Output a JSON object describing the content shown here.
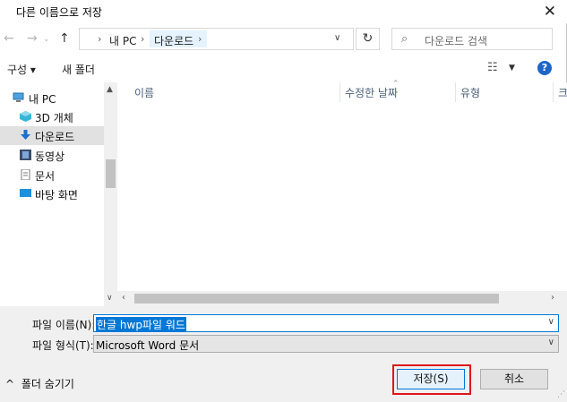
{
  "window": {
    "title": "다른 이름으로 저장"
  },
  "address": {
    "crumbs": [
      "내 PC",
      "다운로드"
    ],
    "search_placeholder": "다운로드 검색"
  },
  "toolbar": {
    "organize": "구성 ▾",
    "new_folder": "새 폴더"
  },
  "nav": {
    "items": [
      {
        "label": "내 PC",
        "icon": "computer-icon"
      },
      {
        "label": "3D 개체",
        "icon": "cube-icon"
      },
      {
        "label": "다운로드",
        "icon": "download-arrow-icon"
      },
      {
        "label": "동영상",
        "icon": "film-icon"
      },
      {
        "label": "문서",
        "icon": "document-icon"
      },
      {
        "label": "바탕 화면",
        "icon": "desktop-icon"
      }
    ]
  },
  "filelist": {
    "columns": [
      "이름",
      "수정한 날짜",
      "유형",
      "크"
    ]
  },
  "bottom": {
    "filename_label": "파일 이름(N):",
    "filename_value": "한글 hwp파일 워드",
    "filetype_label": "파일 형식(T):",
    "filetype_value": "Microsoft Word 문서",
    "toggle_folders": "폴더 숨기기",
    "save_label": "저장(S)",
    "cancel_label": "취소"
  },
  "colors": {
    "accent": "#0078d7",
    "highlight_box": "#e0141e",
    "help": "#1c66c8"
  }
}
